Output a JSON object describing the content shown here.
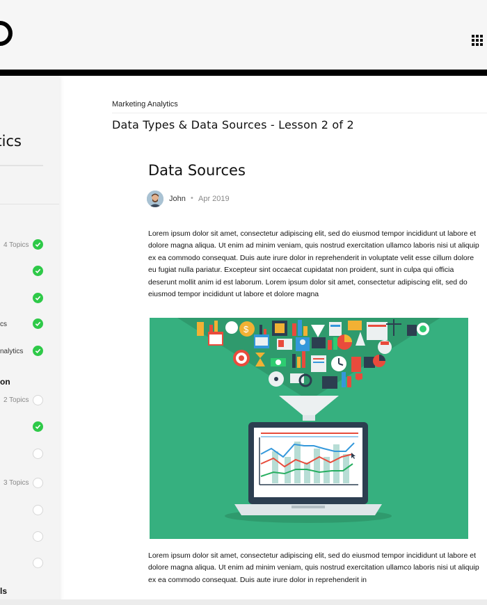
{
  "header": {
    "logo_icon": "circle-logo-icon",
    "apps_icon": "grid-apps-icon"
  },
  "sidebar": {
    "course_title": "ytics",
    "rows": [
      {
        "label": "",
        "topics": "4 Topics",
        "status": "complete"
      },
      {
        "label": "",
        "topics": "",
        "status": "complete"
      },
      {
        "label": "",
        "topics": "",
        "status": "complete"
      },
      {
        "label": "cs",
        "topics": "",
        "status": "complete"
      },
      {
        "label": "nalytics",
        "topics": "",
        "status": "complete"
      },
      {
        "label": "",
        "topics": "2 Topics",
        "status": "incomplete"
      },
      {
        "label": "",
        "topics": "",
        "status": "complete"
      },
      {
        "label": "",
        "topics": "",
        "status": "incomplete"
      },
      {
        "label": "",
        "topics": "3 Topics",
        "status": "incomplete"
      },
      {
        "label": "",
        "topics": "",
        "status": "incomplete"
      },
      {
        "label": "",
        "topics": "",
        "status": "incomplete"
      },
      {
        "label": "",
        "topics": "",
        "status": "incomplete"
      }
    ],
    "section_heads": [
      "on",
      "ls"
    ]
  },
  "breadcrumb": "Marketing Analytics",
  "lesson_title": "Data Types & Data Sources - Lesson 2 of 2",
  "article": {
    "title": "Data Sources",
    "author": "John",
    "separator": "•",
    "date": "Apr 2019",
    "paragraph1": "Lorem ipsum dolor sit amet, consectetur adipiscing elit, sed do eiusmod tempor incididunt ut labore et dolore magna aliqua. Ut enim ad minim veniam, quis nostrud exercitation ullamco laboris nisi ut aliquip ex ea commodo consequat. Duis aute irure dolor in reprehenderit in voluptate velit esse cillum dolore eu fugiat nulla pariatur. Excepteur sint occaecat cupidatat non proident, sunt in culpa qui officia deserunt mollit anim id est laborum. Lorem ipsum dolor sit amet, consectetur adipiscing elit, sed do eiusmod tempor incididunt ut labore et dolore magna",
    "paragraph2": "Lorem ipsum dolor sit amet, consectetur adipiscing elit, sed do eiusmod tempor incididunt ut labore et dolore magna aliqua. Ut enim ad minim veniam, quis nostrud exercitation ullamco laboris nisi ut aliquip ex ea commodo consequat. Duis aute irure dolor in reprehenderit in",
    "hero_illustration": "data-funnel-laptop-illustration"
  },
  "colors": {
    "check_green": "#2ec948",
    "hero_green": "#36b07f",
    "funnel_green": "#2f9a6d"
  }
}
